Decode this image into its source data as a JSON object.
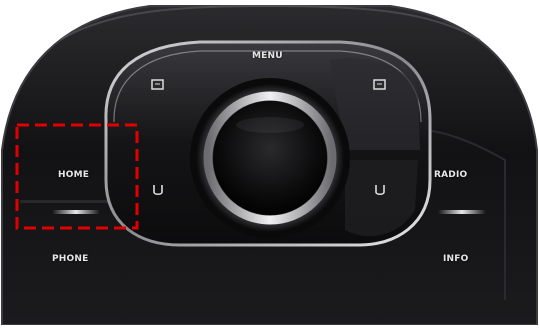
{
  "controller": {
    "menu_label": "MENU",
    "home_label": "HOME",
    "phone_label": "PHONE",
    "radio_label": "RADIO",
    "info_label": "INFO"
  },
  "icons": {
    "left_upper": "option-icon",
    "right_upper": "option-icon",
    "left_lower": "back-icon",
    "right_lower": "back-icon"
  },
  "highlight": {
    "target": "home-button",
    "color": "#e00000"
  }
}
